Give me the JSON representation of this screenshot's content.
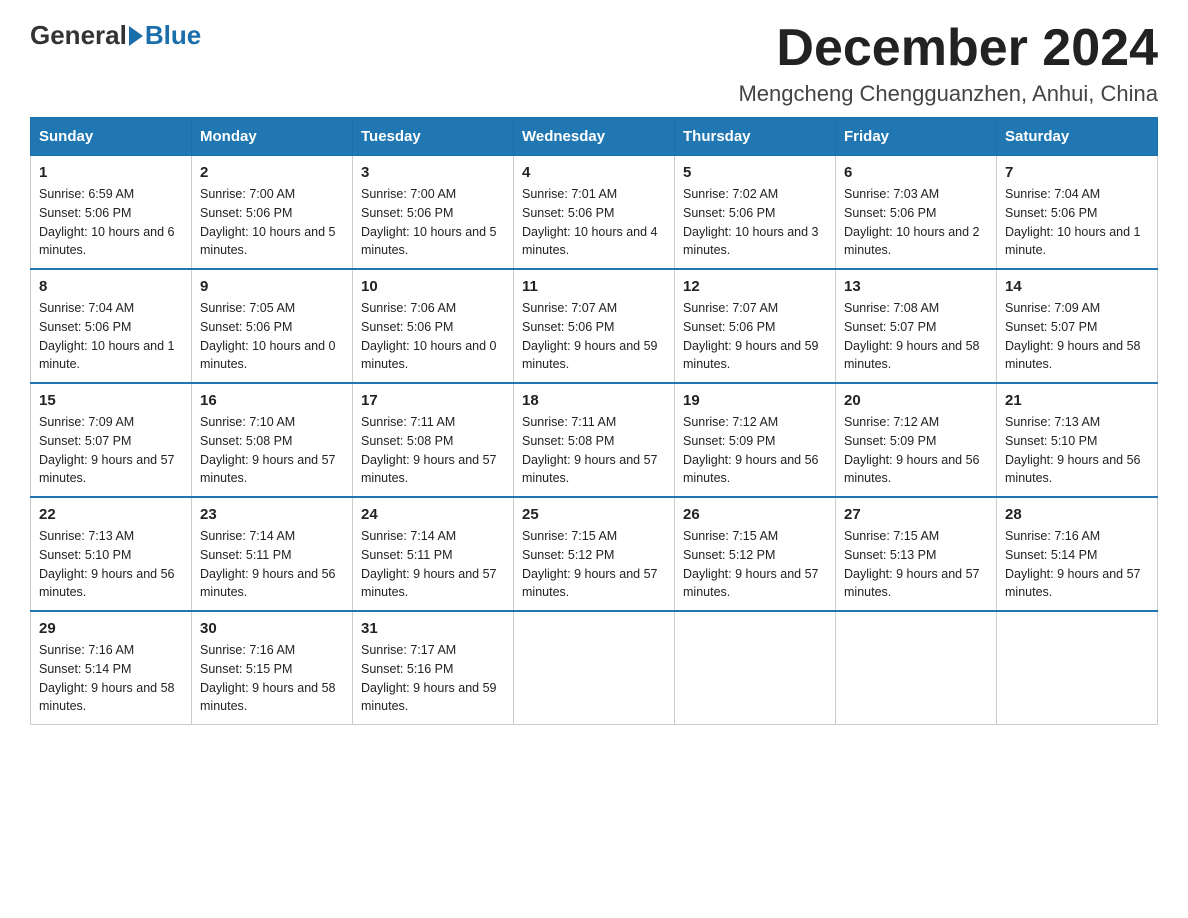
{
  "header": {
    "title": "December 2024",
    "subtitle": "Mengcheng Chengguanzhen, Anhui, China",
    "logo_general": "General",
    "logo_blue": "Blue"
  },
  "columns": [
    "Sunday",
    "Monday",
    "Tuesday",
    "Wednesday",
    "Thursday",
    "Friday",
    "Saturday"
  ],
  "weeks": [
    [
      {
        "day": "1",
        "sunrise": "6:59 AM",
        "sunset": "5:06 PM",
        "daylight": "10 hours and 6 minutes."
      },
      {
        "day": "2",
        "sunrise": "7:00 AM",
        "sunset": "5:06 PM",
        "daylight": "10 hours and 5 minutes."
      },
      {
        "day": "3",
        "sunrise": "7:00 AM",
        "sunset": "5:06 PM",
        "daylight": "10 hours and 5 minutes."
      },
      {
        "day": "4",
        "sunrise": "7:01 AM",
        "sunset": "5:06 PM",
        "daylight": "10 hours and 4 minutes."
      },
      {
        "day": "5",
        "sunrise": "7:02 AM",
        "sunset": "5:06 PM",
        "daylight": "10 hours and 3 minutes."
      },
      {
        "day": "6",
        "sunrise": "7:03 AM",
        "sunset": "5:06 PM",
        "daylight": "10 hours and 2 minutes."
      },
      {
        "day": "7",
        "sunrise": "7:04 AM",
        "sunset": "5:06 PM",
        "daylight": "10 hours and 1 minute."
      }
    ],
    [
      {
        "day": "8",
        "sunrise": "7:04 AM",
        "sunset": "5:06 PM",
        "daylight": "10 hours and 1 minute."
      },
      {
        "day": "9",
        "sunrise": "7:05 AM",
        "sunset": "5:06 PM",
        "daylight": "10 hours and 0 minutes."
      },
      {
        "day": "10",
        "sunrise": "7:06 AM",
        "sunset": "5:06 PM",
        "daylight": "10 hours and 0 minutes."
      },
      {
        "day": "11",
        "sunrise": "7:07 AM",
        "sunset": "5:06 PM",
        "daylight": "9 hours and 59 minutes."
      },
      {
        "day": "12",
        "sunrise": "7:07 AM",
        "sunset": "5:06 PM",
        "daylight": "9 hours and 59 minutes."
      },
      {
        "day": "13",
        "sunrise": "7:08 AM",
        "sunset": "5:07 PM",
        "daylight": "9 hours and 58 minutes."
      },
      {
        "day": "14",
        "sunrise": "7:09 AM",
        "sunset": "5:07 PM",
        "daylight": "9 hours and 58 minutes."
      }
    ],
    [
      {
        "day": "15",
        "sunrise": "7:09 AM",
        "sunset": "5:07 PM",
        "daylight": "9 hours and 57 minutes."
      },
      {
        "day": "16",
        "sunrise": "7:10 AM",
        "sunset": "5:08 PM",
        "daylight": "9 hours and 57 minutes."
      },
      {
        "day": "17",
        "sunrise": "7:11 AM",
        "sunset": "5:08 PM",
        "daylight": "9 hours and 57 minutes."
      },
      {
        "day": "18",
        "sunrise": "7:11 AM",
        "sunset": "5:08 PM",
        "daylight": "9 hours and 57 minutes."
      },
      {
        "day": "19",
        "sunrise": "7:12 AM",
        "sunset": "5:09 PM",
        "daylight": "9 hours and 56 minutes."
      },
      {
        "day": "20",
        "sunrise": "7:12 AM",
        "sunset": "5:09 PM",
        "daylight": "9 hours and 56 minutes."
      },
      {
        "day": "21",
        "sunrise": "7:13 AM",
        "sunset": "5:10 PM",
        "daylight": "9 hours and 56 minutes."
      }
    ],
    [
      {
        "day": "22",
        "sunrise": "7:13 AM",
        "sunset": "5:10 PM",
        "daylight": "9 hours and 56 minutes."
      },
      {
        "day": "23",
        "sunrise": "7:14 AM",
        "sunset": "5:11 PM",
        "daylight": "9 hours and 56 minutes."
      },
      {
        "day": "24",
        "sunrise": "7:14 AM",
        "sunset": "5:11 PM",
        "daylight": "9 hours and 57 minutes."
      },
      {
        "day": "25",
        "sunrise": "7:15 AM",
        "sunset": "5:12 PM",
        "daylight": "9 hours and 57 minutes."
      },
      {
        "day": "26",
        "sunrise": "7:15 AM",
        "sunset": "5:12 PM",
        "daylight": "9 hours and 57 minutes."
      },
      {
        "day": "27",
        "sunrise": "7:15 AM",
        "sunset": "5:13 PM",
        "daylight": "9 hours and 57 minutes."
      },
      {
        "day": "28",
        "sunrise": "7:16 AM",
        "sunset": "5:14 PM",
        "daylight": "9 hours and 57 minutes."
      }
    ],
    [
      {
        "day": "29",
        "sunrise": "7:16 AM",
        "sunset": "5:14 PM",
        "daylight": "9 hours and 58 minutes."
      },
      {
        "day": "30",
        "sunrise": "7:16 AM",
        "sunset": "5:15 PM",
        "daylight": "9 hours and 58 minutes."
      },
      {
        "day": "31",
        "sunrise": "7:17 AM",
        "sunset": "5:16 PM",
        "daylight": "9 hours and 59 minutes."
      },
      null,
      null,
      null,
      null
    ]
  ]
}
